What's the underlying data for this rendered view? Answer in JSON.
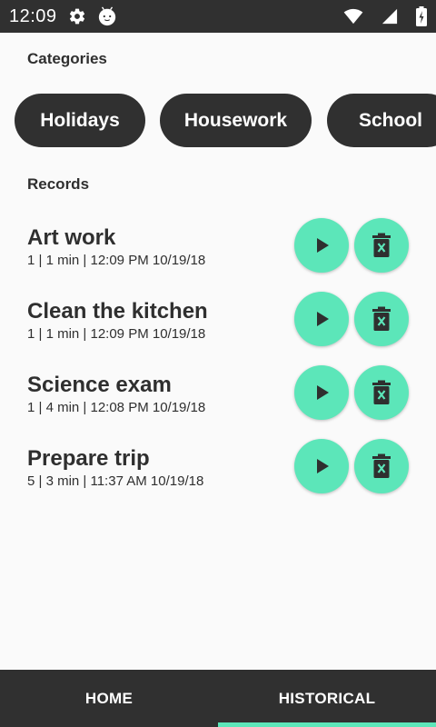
{
  "status_bar": {
    "time": "12:09",
    "icons": [
      "gear-icon",
      "android-face-icon",
      "wifi-icon",
      "signal-icon",
      "battery-icon"
    ]
  },
  "categories": {
    "title": "Categories",
    "items": [
      {
        "label": "Holidays"
      },
      {
        "label": "Housework"
      },
      {
        "label": "School"
      }
    ]
  },
  "records": {
    "title": "Records",
    "items": [
      {
        "title": "Art work",
        "meta": "1 | 1 min | 12:09 PM 10/19/18"
      },
      {
        "title": "Clean the kitchen",
        "meta": "1 | 1 min | 12:09 PM 10/19/18"
      },
      {
        "title": "Science exam",
        "meta": "1 | 4 min | 12:08 PM 10/19/18"
      },
      {
        "title": "Prepare trip",
        "meta": "5 | 3 min | 11:37 AM 10/19/18"
      }
    ],
    "actions": {
      "play_icon": "play-icon",
      "delete_icon": "trash-icon"
    }
  },
  "bottom_nav": {
    "tabs": [
      {
        "label": "HOME",
        "selected": false
      },
      {
        "label": "HISTORICAL",
        "selected": true
      }
    ]
  },
  "colors": {
    "dark": "#303030",
    "accent": "#5ce6b9",
    "background": "#fafafa",
    "text": "#2f2f2f"
  }
}
